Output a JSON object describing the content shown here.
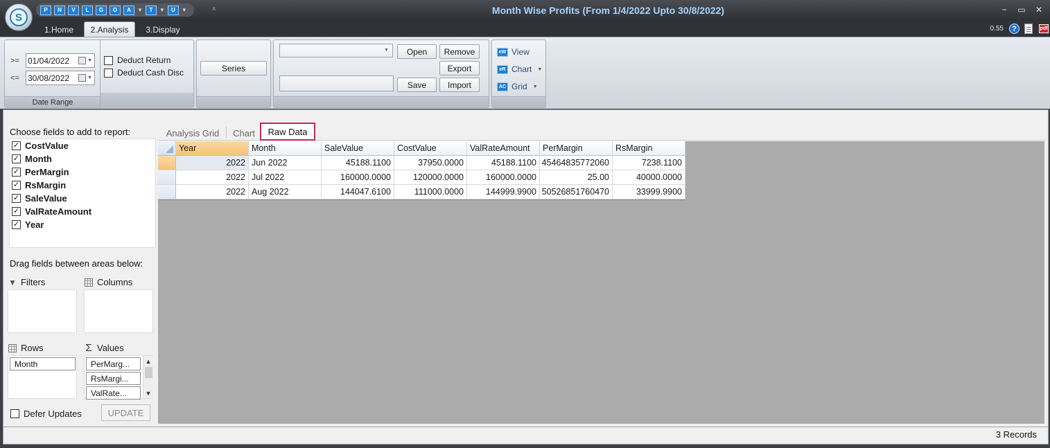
{
  "window": {
    "title": "Month Wise Profits (From 1/4/2022 Upto 30/8/2022)",
    "controls": [
      "−",
      "▭",
      "✕"
    ]
  },
  "quick_access": [
    "P",
    "N",
    "V",
    "L",
    "G",
    "O",
    "A",
    "T",
    "U"
  ],
  "ribbon_tabs": [
    "1.Home",
    "2.Analysis",
    "3.Display"
  ],
  "active_ribbon_tab": "2.Analysis",
  "zoom": "0.55",
  "date_range": {
    "from_op": ">=",
    "from_value": "01/04/2022",
    "to_op": "<=",
    "to_value": "30/08/2022",
    "group_label": "Date Range"
  },
  "options": {
    "deduct_return": "Deduct Return",
    "deduct_cash_disc": "Deduct Cash Disc"
  },
  "series_button": "Series",
  "layout_buttons": {
    "open": "Open",
    "remove": "Remove",
    "export": "Export",
    "save": "Save",
    "import": "Import"
  },
  "view_group": {
    "view": "View",
    "chart": "Chart",
    "grid": "Grid"
  },
  "pivot_panel": {
    "choose_label": "Choose fields to add to report:",
    "fields": [
      "CostValue",
      "Month",
      "PerMargin",
      "RsMargin",
      "SaleValue",
      "ValRateAmount",
      "Year"
    ],
    "drag_label": "Drag fields between areas below:",
    "filters_label": "Filters",
    "columns_label": "Columns",
    "rows_label": "Rows",
    "values_label": "Values",
    "rows_items": [
      "Month"
    ],
    "values_items": [
      "PerMarg...",
      "RsMargi...",
      "ValRate..."
    ],
    "defer_label": "Defer Updates",
    "update_label": "UPDATE"
  },
  "content_tabs": [
    "Analysis Grid",
    "Chart",
    "Raw Data"
  ],
  "active_content_tab": "Raw Data",
  "table": {
    "columns": [
      "Year",
      "Month",
      "SaleValue",
      "CostValue",
      "ValRateAmount",
      "PerMargin",
      "RsMargin"
    ],
    "rows": [
      [
        "2022",
        "Jun 2022",
        "45188.1100",
        "37950.0000",
        "45188.1100",
        "45464835772060",
        "7238.1100"
      ],
      [
        "2022",
        "Jul 2022",
        "160000.0000",
        "120000.0000",
        "160000.0000",
        "25.00",
        "40000.0000"
      ],
      [
        "2022",
        "Aug 2022",
        "144047.6100",
        "111000.0000",
        "144999.9900",
        "50526851760470",
        "33999.9900"
      ]
    ]
  },
  "status": {
    "records": "3 Records"
  }
}
